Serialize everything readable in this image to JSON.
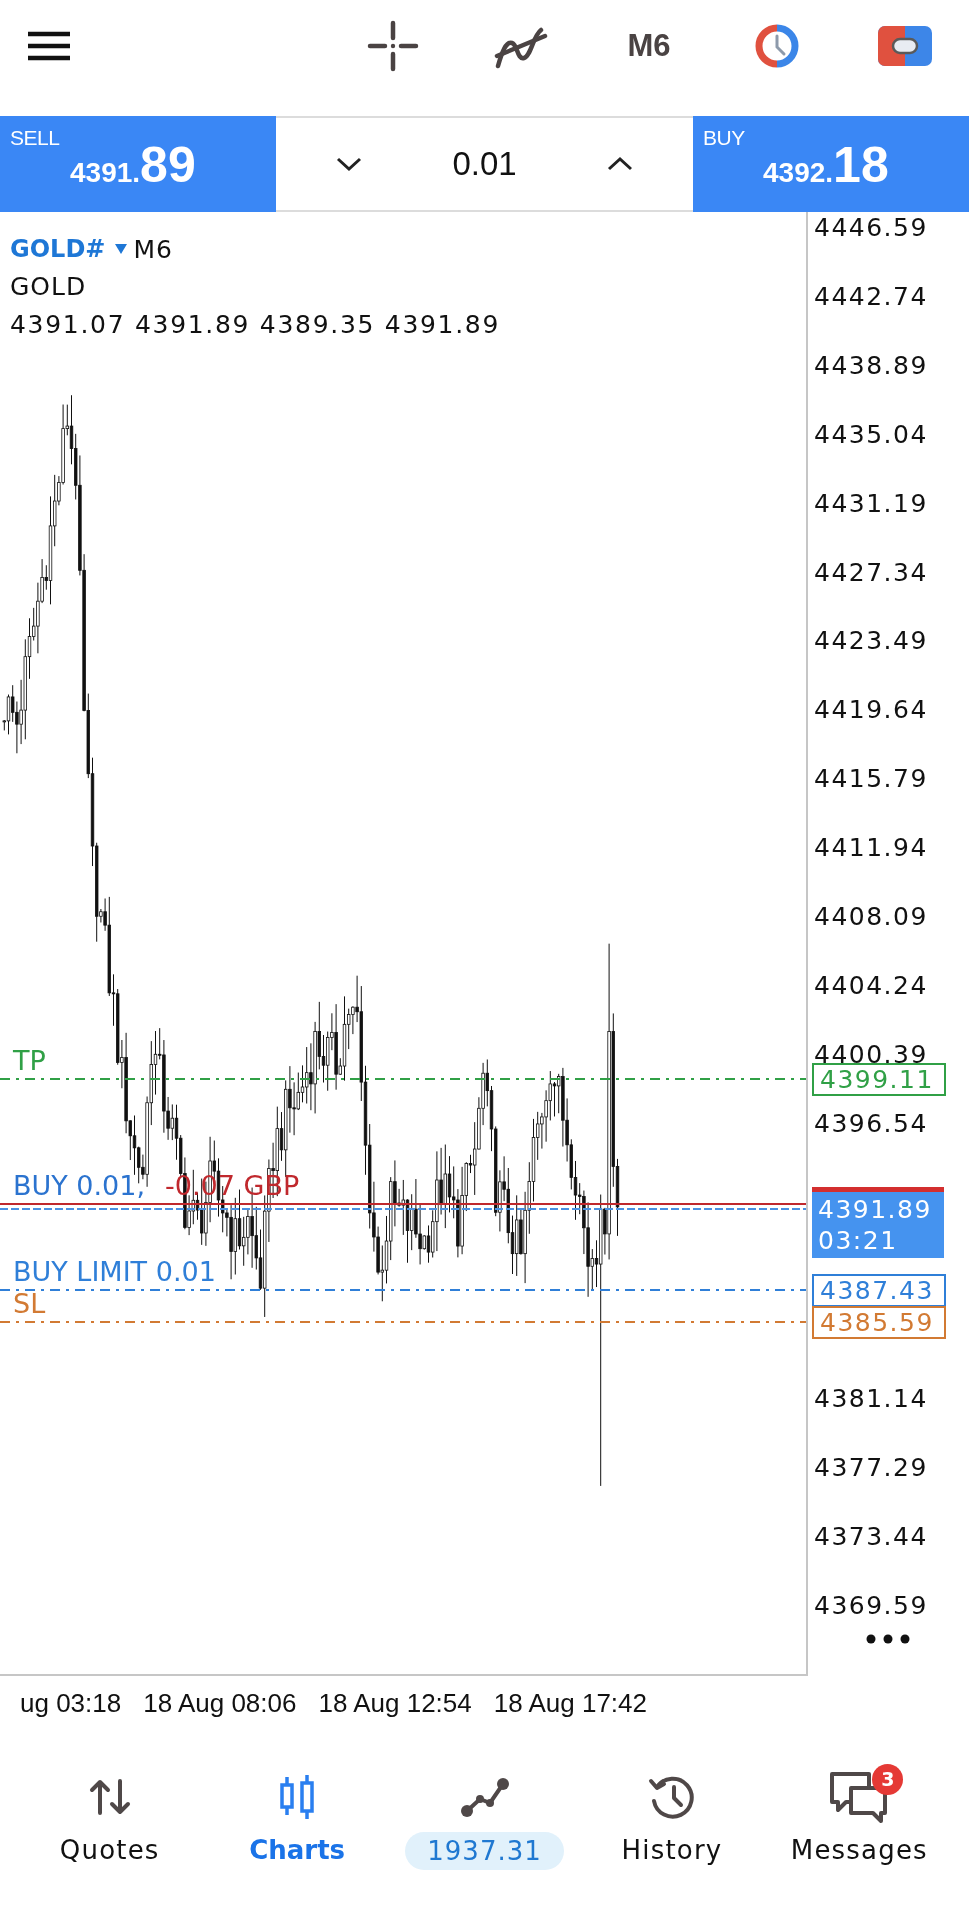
{
  "toolbar": {
    "timeframe": "M6"
  },
  "trade_panel": {
    "sell": {
      "label": "SELL",
      "price_main": "4391.",
      "price_pips": "89"
    },
    "volume": "0.01",
    "buy": {
      "label": "BUY",
      "price_main": "4392.",
      "price_pips": "18"
    }
  },
  "chart": {
    "symbol": "GOLD#",
    "timeframe": "M6",
    "description": "GOLD",
    "ohlc": "4391.07 4391.89 4389.35 4391.89",
    "price_axis": {
      "label_groups": [
        [
          "4446.59",
          "4442.74",
          "4438.89",
          "4435.04",
          "4431.19",
          "4427.34",
          "4423.49",
          "4419.64",
          "4415.79",
          "4411.94",
          "4408.09",
          "4404.24",
          "4400.39",
          "4396.54"
        ],
        [
          "4381.14",
          "4377.29",
          "4373.44",
          "4369.59"
        ]
      ]
    },
    "order_lines": [
      {
        "kind": "take_profit",
        "label": "TP",
        "price": "4399.11",
        "color": "#30a046"
      },
      {
        "kind": "position",
        "label": "BUY 0.01,",
        "profit": "-0.07 GBP",
        "color": "#c0282d"
      },
      {
        "kind": "buy_limit",
        "label": "BUY LIMIT 0.01",
        "price": "4387.43",
        "color": "#2f7fd8"
      },
      {
        "kind": "stop_loss",
        "label": "SL",
        "price": "4385.59",
        "color": "#d27a33"
      }
    ],
    "current_price": {
      "price": "4391.89",
      "countdown": "03:21"
    },
    "time_axis": [
      "ug 03:18",
      "18 Aug 08:06",
      "18 Aug 12:54",
      "18 Aug 17:42"
    ]
  },
  "bottom_nav": [
    {
      "kind": "tab",
      "label": "Quotes",
      "selected": false
    },
    {
      "kind": "tab",
      "label": "Charts",
      "selected": true
    },
    {
      "kind": "balance",
      "label": "1937.31",
      "selected": false
    },
    {
      "kind": "tab",
      "label": "History",
      "selected": false
    },
    {
      "kind": "tab",
      "label": "Messages",
      "selected": false,
      "badge": "3"
    }
  ]
}
